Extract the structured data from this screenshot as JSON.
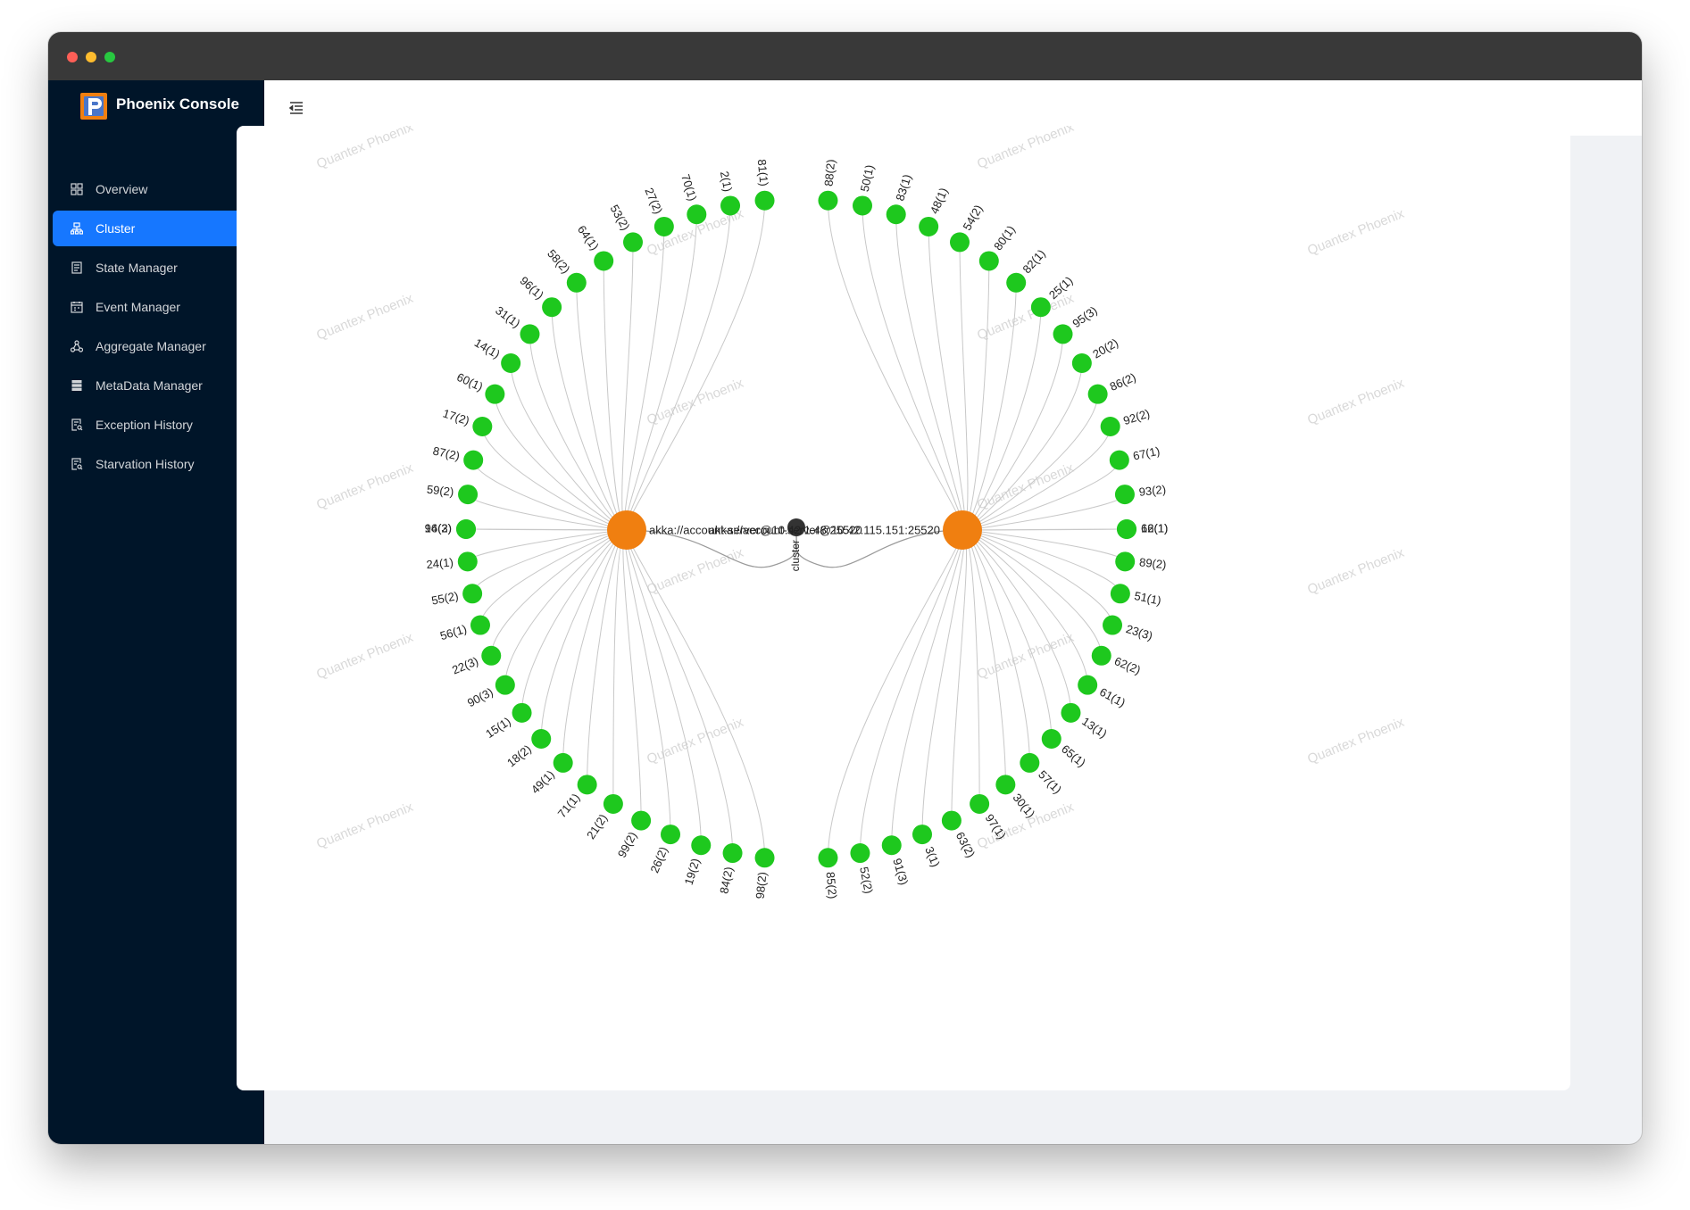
{
  "app": {
    "title": "Phoenix Console",
    "watermark": "Quantex Phoenix"
  },
  "sidebar": {
    "items": [
      {
        "label": "Overview",
        "icon": "dashboard-icon",
        "active": false
      },
      {
        "label": "Cluster",
        "icon": "cluster-icon",
        "active": true
      },
      {
        "label": "State Manager",
        "icon": "document-icon",
        "active": false
      },
      {
        "label": "Event Manager",
        "icon": "calendar-icon",
        "active": false
      },
      {
        "label": "Aggregate Manager",
        "icon": "hierarchy-icon",
        "active": false
      },
      {
        "label": "MetaData Manager",
        "icon": "database-icon",
        "active": false
      },
      {
        "label": "Exception History",
        "icon": "file-search-icon",
        "active": false
      },
      {
        "label": "Starvation History",
        "icon": "file-search-icon",
        "active": false
      }
    ]
  },
  "header": {
    "menu_toggle_icon": "menu-fold-icon"
  },
  "colors": {
    "sidebar_bg": "#001529",
    "accent": "#1677ff",
    "member_node": "#f07f10",
    "leaf_node": "#1ec81e",
    "center_node": "#333333",
    "edge": "#c8c8c8"
  },
  "graph": {
    "center": {
      "label": "cluster"
    },
    "members": [
      {
        "label": "akka://account-server@10.42.1.48:25520"
      },
      {
        "label": "akka://account-server@10.42.115.151:25520"
      }
    ],
    "left_top": [
      "81(1)",
      "2(1)",
      "70(1)",
      "27(2)",
      "53(2)",
      "64(1)",
      "58(2)",
      "96(1)",
      "31(1)",
      "14(1)",
      "60(1)",
      "17(2)",
      "87(2)",
      "59(2)",
      "16(2)"
    ],
    "left_bottom": [
      "94(3)",
      "24(1)",
      "55(2)",
      "56(1)",
      "22(3)",
      "90(3)",
      "15(1)",
      "18(2)",
      "49(1)",
      "71(1)",
      "21(2)",
      "99(2)",
      "26(2)",
      "19(2)",
      "84(2)",
      "98(2)"
    ],
    "right_top": [
      "88(2)",
      "50(1)",
      "83(1)",
      "48(1)",
      "54(2)",
      "80(1)",
      "82(1)",
      "25(1)",
      "95(3)",
      "20(2)",
      "86(2)",
      "92(2)",
      "67(1)",
      "93(2)",
      "12(1)"
    ],
    "right_bottom": [
      "66(1)",
      "89(2)",
      "51(1)",
      "23(3)",
      "62(2)",
      "61(1)",
      "13(1)",
      "65(1)",
      "57(1)",
      "30(1)",
      "97(1)",
      "63(2)",
      "3(1)",
      "91(3)",
      "52(2)",
      "85(2)"
    ]
  }
}
